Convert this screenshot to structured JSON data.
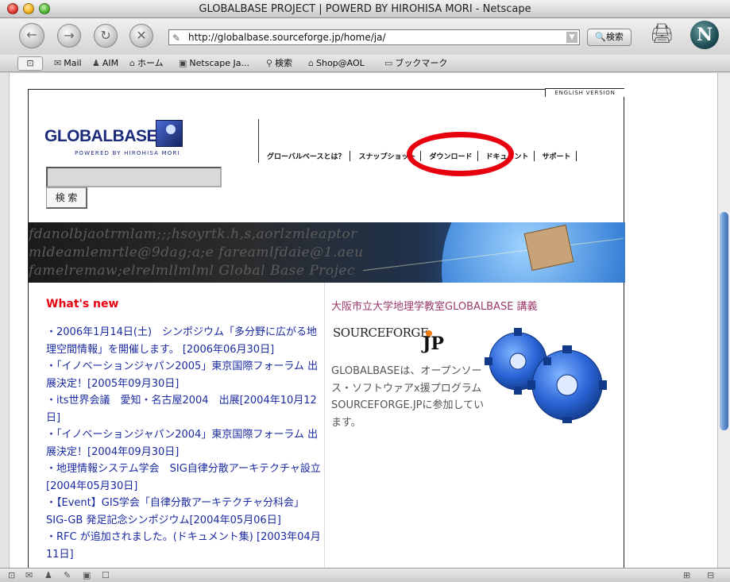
{
  "window": {
    "title": "GLOBALBASE PROJECT | POWERD BY HIROHISA MORI - Netscape"
  },
  "toolbar": {
    "url": "http://globalbase.sourceforge.jp/home/ja/",
    "search_label": "検索"
  },
  "personal_toolbar": {
    "items": [
      "Mail",
      "AIM",
      "ホーム",
      "Netscape Ja...",
      "検索",
      "Shop@AOL",
      "ブックマーク"
    ]
  },
  "page": {
    "english_version": "ENGLISH VERSION",
    "logo_word": "GLOBALBASE",
    "logo_sub": "POWERED BY HIROHISA MORI",
    "search_button": "検 索",
    "nav": [
      "グローバルベースとは？",
      "スナップショット",
      "ダウンロード",
      "ドキュメント",
      "サポート"
    ],
    "banner_text": [
      "fdanolbjaotrmlam;;;hsoyrtk.h,s,aorlzmleaptor",
      "mldeamlemrtle@9dag;a;e fareamlfdaie@1.aeu",
      "famelremaw;elrelmllmlml Global Base Projec"
    ],
    "whats_new_title": "What's new",
    "news": [
      "・2006年1月14日(土)　シンポジウム「多分野に広がる地理空間情報」を開催します。 [2006年06月30日]",
      "・「イノベーションジャパン2005」東京国際フォーラム 出展決定！[2005年09月30日]",
      "・its世界会議　愛知・名古屋2004　出展[2004年10月12日]",
      "・「イノベーションジャパン2004」東京国際フォーラム 出展決定！[2004年09月30日]",
      "・地理情報システム学会　SIG自律分散アーキテクチャ設立 [2004年05月30日]",
      "・【Event】GIS学会「自律分散アーキテクチャ分科会」SIG-GB 発足記念シンポジウム[2004年05月06日]",
      "・RFC が追加されました。(ドキュメント集) [2003年04月11日]"
    ],
    "right_title": "大阪市立大学地理学教室GLOBALBASE 講義",
    "sf_logo_a": "SOURCEFORGE",
    "sf_logo_b": "JP",
    "right_body": "GLOBALBASEは、オープンソース・ソフトウァアx援プログラムSOURCEFORGE.JPに参加しています。"
  },
  "colors": {
    "accent_red": "#e8000f",
    "link_blue": "#1a2aa0",
    "title_purple": "#9a3a6a",
    "logo_navy": "#1c2a7a"
  }
}
